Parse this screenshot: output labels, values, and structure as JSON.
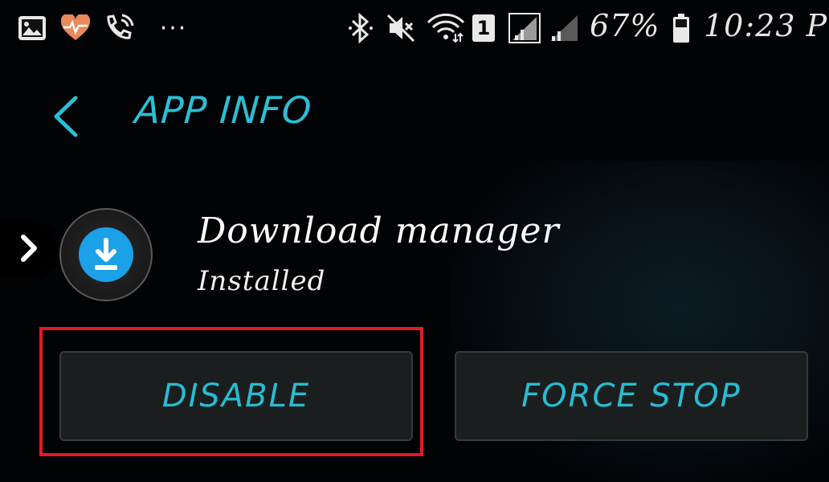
{
  "status_bar": {
    "icons": [
      "gallery-icon",
      "health-heart-icon",
      "wifi-call-icon",
      "more-dots-icon",
      "bluetooth-icon",
      "mute-icon",
      "wifi-icon",
      "sim-icon",
      "signal-icon",
      "signal-icon-2",
      "battery-icon"
    ],
    "sim_label": "1",
    "battery_percent": "67%",
    "time": "10:23 P"
  },
  "header": {
    "title": "APP INFO"
  },
  "app": {
    "name": "Download manager",
    "status": "Installed",
    "icon": "download-icon"
  },
  "buttons": {
    "disable_label": "DISABLE",
    "force_stop_label": "FORCE STOP"
  },
  "colors": {
    "accent": "#2bbfd6",
    "app_icon_bg": "#1aa1e8",
    "highlight": "#e01b24",
    "background": "#020305"
  }
}
